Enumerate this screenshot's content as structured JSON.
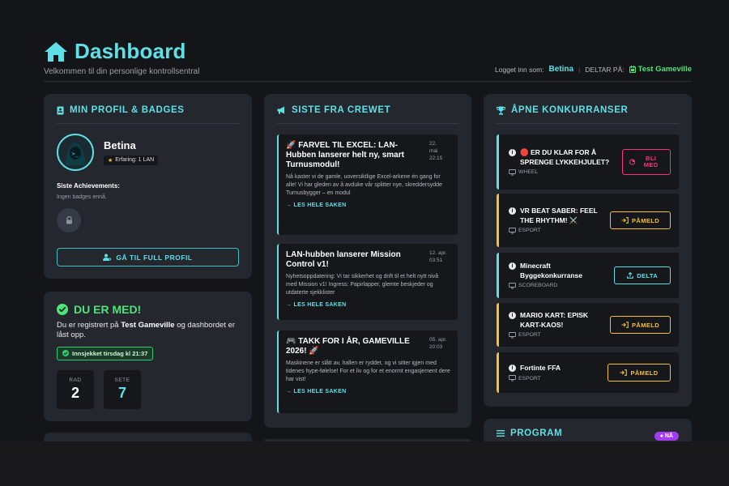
{
  "header": {
    "title": "Dashboard",
    "subtitle": "Velkommen til din personlige kontrollsentral",
    "logged_in_label": "Logget inn som:",
    "user": "Betina",
    "participating_label": "DELTAR PÅ:",
    "event": "Test Gameville"
  },
  "profile": {
    "section_title": "MIN PROFIL & BADGES",
    "name": "Betina",
    "xp": "Erfaring: 1 LAN",
    "achievements_title": "Siste Achievements:",
    "achievements_empty": "Ingen badges ennå.",
    "button_label": "GÅ TIL FULL PROFIL"
  },
  "status": {
    "title": "DU ER MED!",
    "text_prefix": "Du er registrert på",
    "text_event": "Test Gameville",
    "text_suffix": "og dashbordet er låst opp.",
    "checkin": "Innsjekket tirsdag kl 21:37",
    "seat_row_label": "RAD",
    "seat_row_value": "2",
    "seat_label": "SETE",
    "seat_value": "7"
  },
  "news": {
    "section_title": "SISTE FRA CREWET",
    "read_more": "→ LES HELE SAKEN",
    "items": [
      {
        "title": "🚀 FARVEL TIL EXCEL: LAN-Hubben lanserer helt ny, smart Turnusmodul!",
        "date": "22.\nmai\n22:15",
        "body": "Nå kaster vi de gamle, uoversiktlige Excel-arkene én gang for alle! Vi har gleden av å avduke vår splitter nye, skreddersydde Turnusbygger – en modul"
      },
      {
        "title": "LAN-hubben lanserer Mission Control v1!",
        "date": "12. apr.\n03:51",
        "body": "Nyhetsoppdatering: Vi tar sikkerhet og drift til et helt nytt nivå med Mission v1! Ingress: Papirlapper, glemte beskjeder og utdaterte sjekklister"
      },
      {
        "title": "🎮 TAKK FOR I ÅR, GAMEVILLE 2026! 🚀",
        "date": "05. apr.\n20:03",
        "body": "Maskinene er slått av, hallen er ryddet, og vi sitter igjen med tidenes hype-følelse! For et liv og for et enormt engasjement dere har vist!"
      }
    ]
  },
  "competitions": {
    "section_title": "ÅPNE KONKURRANSER",
    "items": [
      {
        "title": "🛑 ER DU KLAR FOR Å SPRENGE LYKKEHJULET?",
        "category": "WHEEL",
        "button": "BLI MED",
        "style": "pink"
      },
      {
        "title": "VR BEAT SABER: FEEL THE RHYTHM! ⚔️",
        "category": "ESPORT",
        "button": "PÅMELD",
        "style": "yellow"
      },
      {
        "title": "Minecraft Byggekonkurranse",
        "category": "SCOREBOARD",
        "button": "DELTA",
        "style": "cyan"
      },
      {
        "title": "MARIO KART: EPISK KART-KAOS!",
        "category": "ESPORT",
        "button": "PÅMELD",
        "style": "yellow"
      },
      {
        "title": "Fortinte FFA",
        "category": "ESPORT",
        "button": "PÅMELD",
        "style": "yellow"
      }
    ]
  },
  "program": {
    "section_title": "PROGRAM",
    "badge": "NÅ"
  },
  "colors": {
    "accent": "#5ee0e6",
    "success": "#4fe37a",
    "warning": "#f2c230",
    "danger": "#ff2f7a",
    "purple": "#a43cf0",
    "card": "#24272d",
    "background": "#141518"
  }
}
